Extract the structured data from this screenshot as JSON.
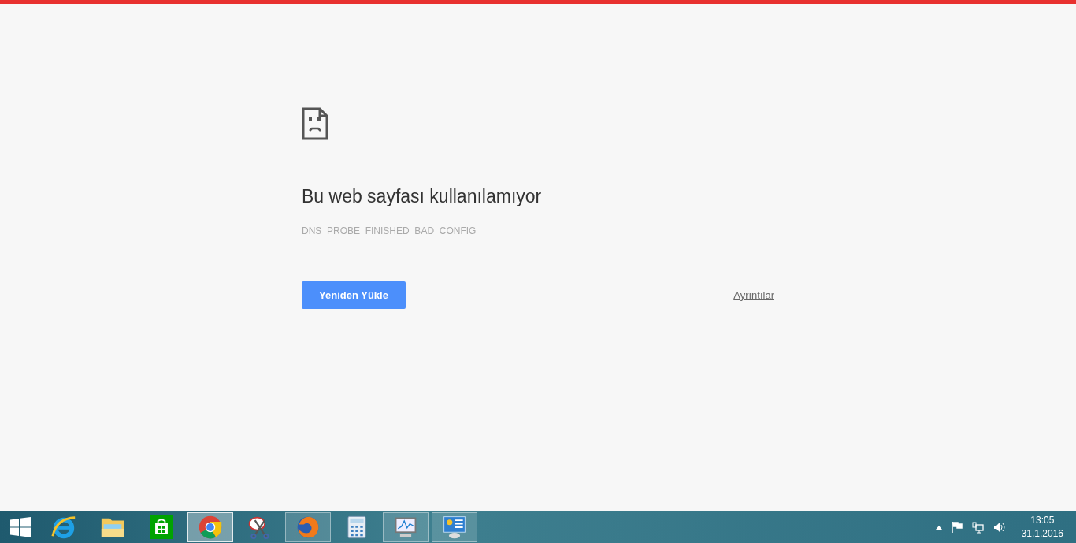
{
  "error_page": {
    "heading": "Bu web sayfası kullanılamıyor",
    "error_code": "DNS_PROBE_FINISHED_BAD_CONFIG",
    "reload_button": "Yeniden Yükle",
    "details_link": "Ayrıntılar"
  },
  "taskbar": {
    "apps": [
      {
        "kind": "ie",
        "running": false,
        "selected": false
      },
      {
        "kind": "explorer",
        "running": false,
        "selected": false
      },
      {
        "kind": "store",
        "running": false,
        "selected": false
      },
      {
        "kind": "chrome",
        "running": true,
        "selected": true
      },
      {
        "kind": "snipping",
        "running": false,
        "selected": false
      },
      {
        "kind": "firefox",
        "running": true,
        "selected": false
      },
      {
        "kind": "calculator",
        "running": false,
        "selected": false
      },
      {
        "kind": "monitor",
        "running": true,
        "selected": false
      },
      {
        "kind": "control",
        "running": true,
        "selected": false
      }
    ],
    "clock": {
      "time": "13:05",
      "date": "31.1.2016"
    }
  }
}
